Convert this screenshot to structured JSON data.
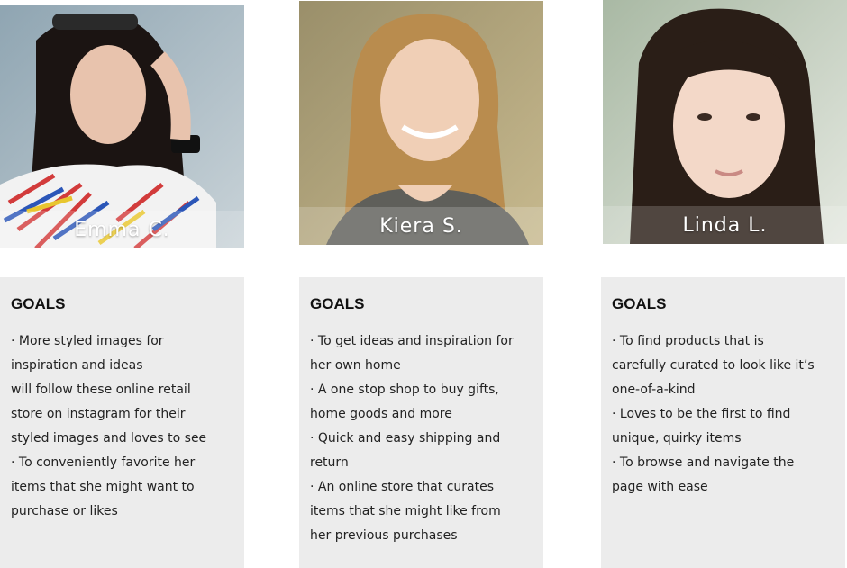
{
  "personas": [
    {
      "name": "Emma C.",
      "goals_title": "GOALS",
      "goals": [
        "· More styled images for\ninspiration and ideas\nwill follow these online retail\nstore on instagram for their\nstyled images and loves to see",
        "· To conveniently favorite her\nitems that she might want to\npurchase or likes"
      ]
    },
    {
      "name": "Kiera S.",
      "goals_title": "GOALS",
      "goals": [
        "· To get ideas and inspiration for\nher own home",
        "· A one stop shop to buy gifts,\nhome goods and more",
        "· Quick and easy shipping and\nreturn",
        "· An online store that curates\nitems that she might like from\nher previous purchases"
      ]
    },
    {
      "name": "Linda L.",
      "goals_title": "GOALS",
      "goals": [
        "· To find products that is\ncarefully curated to look like it’s\none-of-a-kind",
        "· Loves to be the first to find\nunique, quirky items",
        "· To browse and navigate the\npage  with ease"
      ]
    }
  ]
}
